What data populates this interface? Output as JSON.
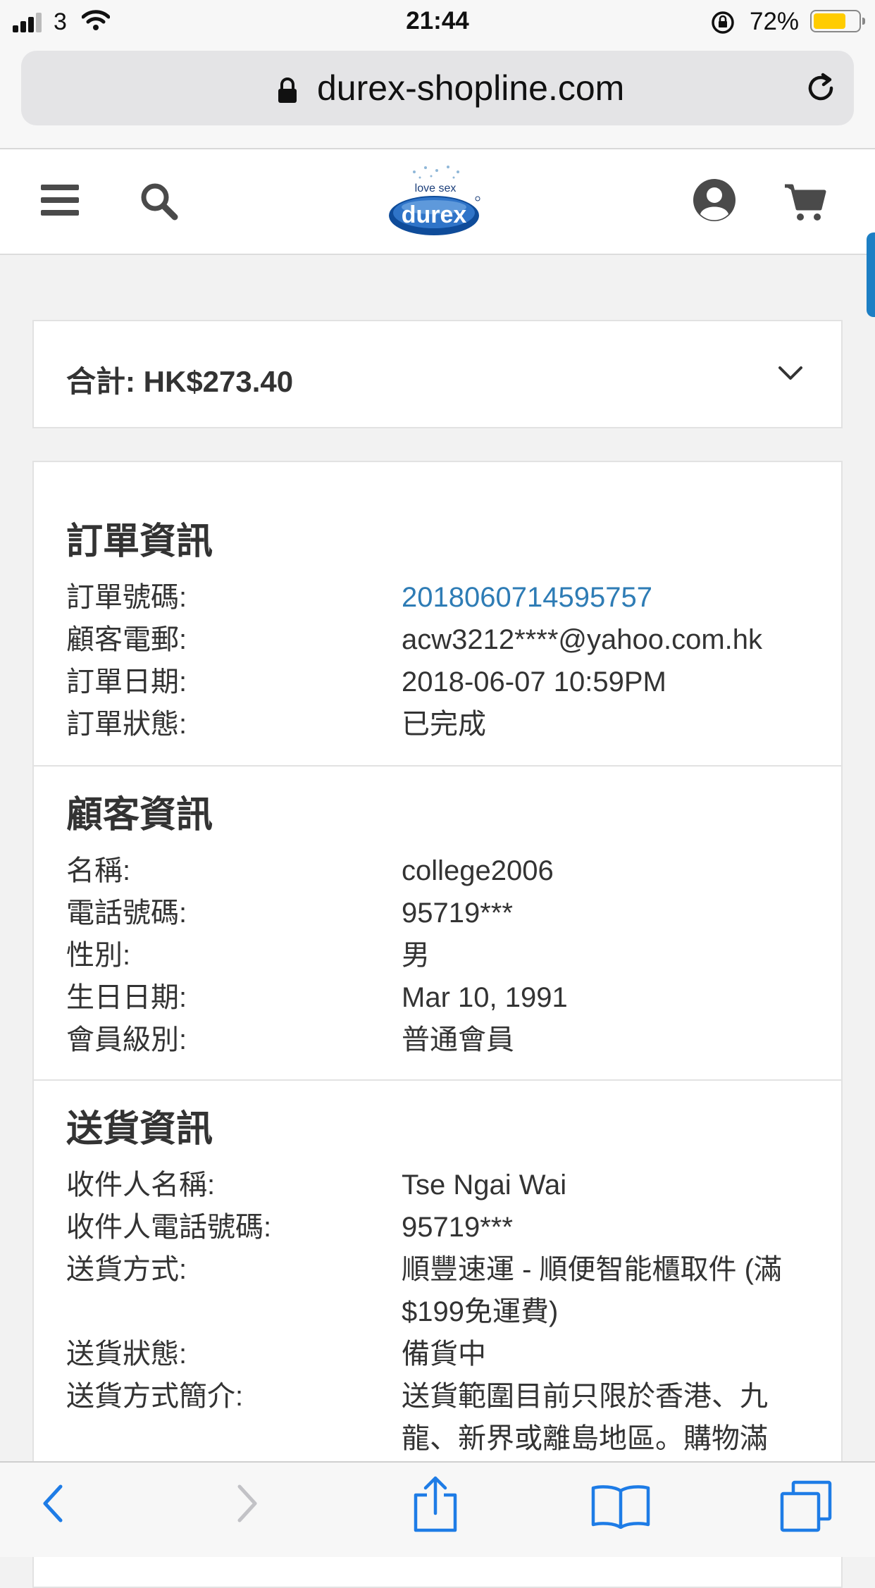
{
  "status_bar": {
    "carrier": "3",
    "time": "21:44",
    "battery_percent": "72%",
    "battery_level": 0.72
  },
  "browser": {
    "url": "durex-shopline.com"
  },
  "header": {
    "logo_tagline": "love sex",
    "logo_text": "durex"
  },
  "summary": {
    "total_label": "合計: HK$273.40"
  },
  "order_info": {
    "title": "訂單資訊",
    "rows": [
      {
        "label": "訂單號碼:",
        "value": "2018060714595757"
      },
      {
        "label": "顧客電郵:",
        "value": "acw3212****@yahoo.com.hk"
      },
      {
        "label": "訂單日期:",
        "value": "2018-06-07 10:59PM"
      },
      {
        "label": "訂單狀態:",
        "value": "已完成"
      }
    ]
  },
  "customer_info": {
    "title": "顧客資訊",
    "rows": [
      {
        "label": "名稱:",
        "value": "college2006"
      },
      {
        "label": "電話號碼:",
        "value": "95719***"
      },
      {
        "label": "性別:",
        "value": "男"
      },
      {
        "label": "生日日期:",
        "value": "Mar 10, 1991"
      },
      {
        "label": "會員級別:",
        "value": "普通會員"
      }
    ]
  },
  "delivery_info": {
    "title": "送貨資訊",
    "rows": [
      {
        "label": "收件人名稱:",
        "value": "Tse Ngai Wai"
      },
      {
        "label": "收件人電話號碼:",
        "value": "95719***"
      },
      {
        "label": "送貨方式:",
        "value_line1": "順豐速運 - 順便智能櫃取件 (滿",
        "value_line2": "$199免運費)"
      },
      {
        "label": "送貨狀態:",
        "value": "備貨中"
      },
      {
        "label": "送貨方式簡介:",
        "value_line1": "送貨範圍目前只限於香港、九",
        "value_line2": "龍、新界或離島地區。購物滿"
      }
    ]
  },
  "colors": {
    "link": "#2e7cb5",
    "ios_blue": "#1e7ce6",
    "battery": "#ffcc00"
  },
  "icons": [
    "signal-icon",
    "wifi-icon",
    "orientation-lock-icon",
    "battery-icon",
    "lock-icon",
    "reload-icon",
    "menu-icon",
    "search-icon",
    "account-icon",
    "cart-icon",
    "chevron-down-icon",
    "back-icon",
    "forward-icon",
    "share-icon",
    "bookmarks-icon",
    "tabs-icon"
  ]
}
